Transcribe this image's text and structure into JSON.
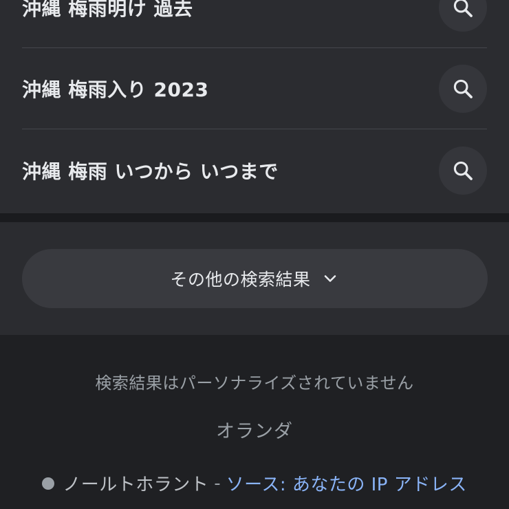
{
  "suggestions": [
    {
      "text": "沖縄 梅雨明け 過去"
    },
    {
      "text": "沖縄 梅雨入り 2023"
    },
    {
      "text": "沖縄 梅雨 いつから いつまで"
    }
  ],
  "more_results": {
    "label": "その他の検索結果"
  },
  "footer": {
    "personalization_note": "検索結果はパーソナライズされていません",
    "country": "オランダ",
    "location_city": "ノールトホラント",
    "separator": "-",
    "location_source": "ソース: あなたの IP アドレス"
  },
  "colors": {
    "background": "#202124",
    "card": "#2b2c30",
    "text": "#e8eaed",
    "muted": "#9aa0a6",
    "link": "#8ab4f8"
  },
  "icons": {
    "suggestion_action": "search-icon",
    "more_results": "chevron-down-icon",
    "location": "location-dot-icon"
  }
}
